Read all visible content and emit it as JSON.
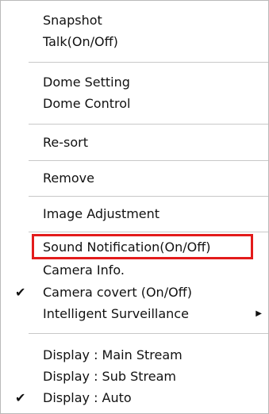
{
  "context_menu": {
    "items": [
      {
        "label": "Snapshot"
      },
      {
        "label": "Talk(On/Off)"
      },
      {
        "label": "Dome Setting"
      },
      {
        "label": "Dome Control"
      },
      {
        "label": "Re-sort"
      },
      {
        "label": "Remove"
      },
      {
        "label": "Image Adjustment"
      },
      {
        "label": "Sound Notification(On/Off)"
      },
      {
        "label": "Camera Info."
      },
      {
        "label": "Camera covert (On/Off)",
        "check": "✔"
      },
      {
        "label": "Intelligent Surveillance",
        "arrow": "▶"
      },
      {
        "label": "Display : Main Stream"
      },
      {
        "label": "Display : Sub Stream"
      },
      {
        "label": "Display : Auto",
        "check": "✔"
      }
    ],
    "highlight_color": "#e31b1b",
    "icons": {
      "checkmark": "checkmark-icon",
      "submenu": "submenu-arrow-icon"
    }
  }
}
